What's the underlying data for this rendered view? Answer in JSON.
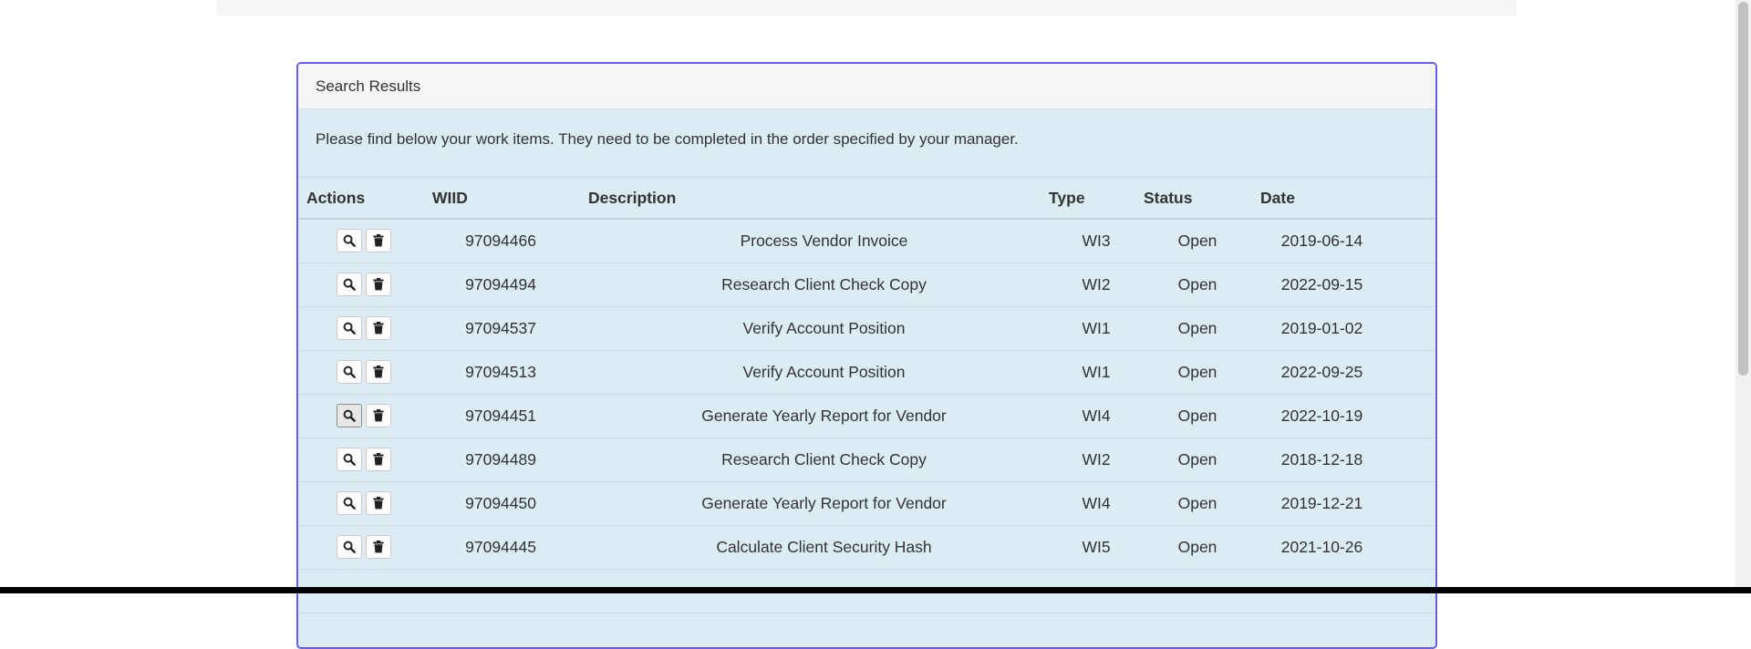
{
  "panel": {
    "title": "Search Results",
    "intro": "Please find below your work items. They need to be completed in the order specified by your manager."
  },
  "table": {
    "headers": {
      "actions": "Actions",
      "wiid": "WIID",
      "description": "Description",
      "type": "Type",
      "status": "Status",
      "date": "Date"
    },
    "rows": [
      {
        "wiid": "97094466",
        "description": "Process Vendor Invoice",
        "type": "WI3",
        "status": "Open",
        "date": "2019-06-14"
      },
      {
        "wiid": "97094494",
        "description": "Research Client Check Copy",
        "type": "WI2",
        "status": "Open",
        "date": "2022-09-15"
      },
      {
        "wiid": "97094537",
        "description": "Verify Account Position",
        "type": "WI1",
        "status": "Open",
        "date": "2019-01-02"
      },
      {
        "wiid": "97094513",
        "description": "Verify Account Position",
        "type": "WI1",
        "status": "Open",
        "date": "2022-09-25"
      },
      {
        "wiid": "97094451",
        "description": "Generate Yearly Report for Vendor",
        "type": "WI4",
        "status": "Open",
        "date": "2022-10-19"
      },
      {
        "wiid": "97094489",
        "description": "Research Client Check Copy",
        "type": "WI2",
        "status": "Open",
        "date": "2018-12-18"
      },
      {
        "wiid": "97094450",
        "description": "Generate Yearly Report for Vendor",
        "type": "WI4",
        "status": "Open",
        "date": "2019-12-21"
      },
      {
        "wiid": "97094445",
        "description": "Calculate Client Security Hash",
        "type": "WI5",
        "status": "Open",
        "date": "2021-10-26"
      },
      {
        "wiid": "",
        "description": "",
        "type": "",
        "status": "",
        "date": ""
      }
    ]
  },
  "icons": {
    "view": "search-icon",
    "delete": "trash-icon"
  }
}
